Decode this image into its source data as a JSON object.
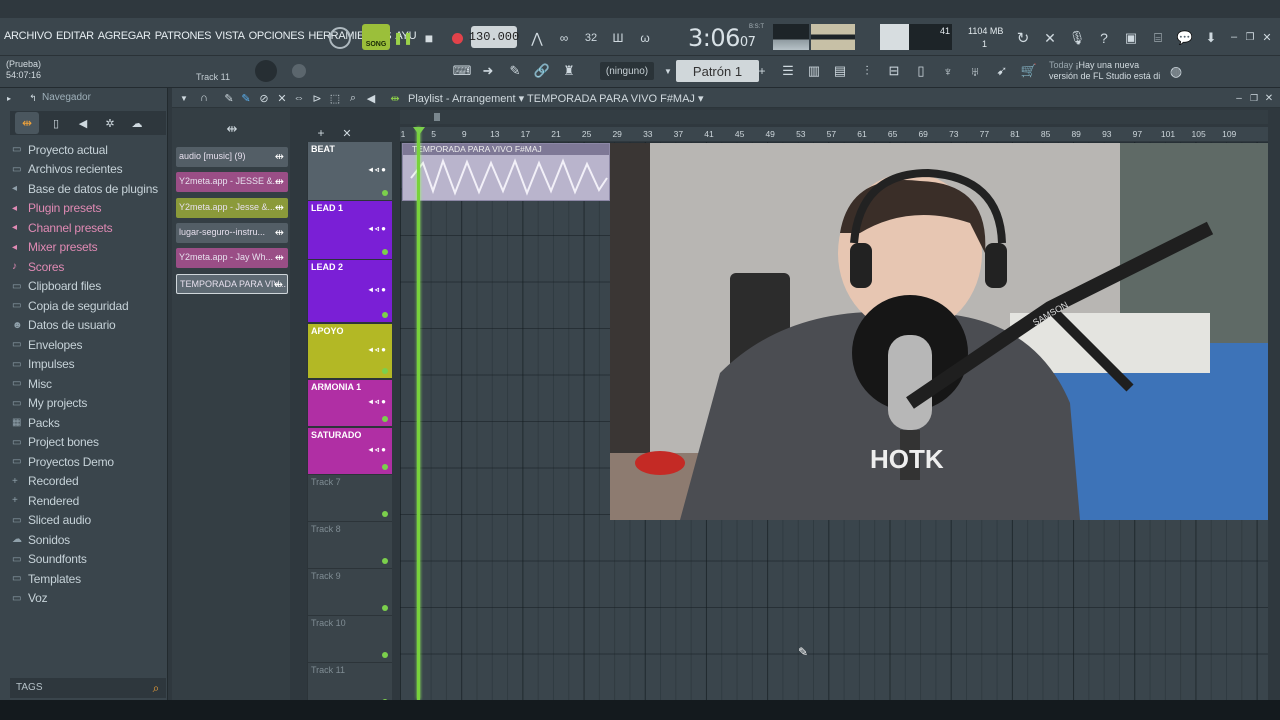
{
  "menu": {
    "items": [
      "ARCHIVO",
      "EDITAR",
      "AGREGAR",
      "PATRONES",
      "VISTA",
      "OPCIONES",
      "HERRAMIENTAS",
      "AYU"
    ]
  },
  "transport": {
    "song_label": "SONG",
    "tempo": "130.000",
    "time_main": "3:06",
    "time_sub": "07",
    "time_top": "B:S:T"
  },
  "monitor": {
    "cpu_value": "41",
    "memory": "1104 MB",
    "voices": "1"
  },
  "hint": {
    "line1": "(Prueba)",
    "line2": "54:07:16",
    "track": "Track 11"
  },
  "pattern": {
    "selector": "(ninguno)",
    "name": "Patrón 1"
  },
  "news": {
    "label": "Today",
    "line1": "¡Hay una nueva",
    "line2": "versión de FL Studio está di"
  },
  "browser": {
    "title": "Navegador",
    "items": [
      {
        "label": "Proyecto actual",
        "icon": "folder-icon",
        "color": "normal"
      },
      {
        "label": "Archivos recientes",
        "icon": "folder-icon",
        "color": "normal"
      },
      {
        "label": "Base de datos de plugins",
        "icon": "plug-icon",
        "color": "normal"
      },
      {
        "label": "Plugin presets",
        "icon": "plug-icon",
        "color": "pink"
      },
      {
        "label": "Channel presets",
        "icon": "plug-icon",
        "color": "pink"
      },
      {
        "label": "Mixer presets",
        "icon": "plug-icon",
        "color": "pink"
      },
      {
        "label": "Scores",
        "icon": "note-icon",
        "color": "pink"
      },
      {
        "label": "Clipboard files",
        "icon": "folder-icon",
        "color": "normal"
      },
      {
        "label": "Copia de seguridad",
        "icon": "folder-icon",
        "color": "normal"
      },
      {
        "label": "Datos de usuario",
        "icon": "user-icon",
        "color": "normal"
      },
      {
        "label": "Envelopes",
        "icon": "folder-icon",
        "color": "normal"
      },
      {
        "label": "Impulses",
        "icon": "folder-icon",
        "color": "normal"
      },
      {
        "label": "Misc",
        "icon": "folder-icon",
        "color": "normal"
      },
      {
        "label": "My projects",
        "icon": "folder-icon",
        "color": "normal"
      },
      {
        "label": "Packs",
        "icon": "pack-icon",
        "color": "normal"
      },
      {
        "label": "Project bones",
        "icon": "folder-icon",
        "color": "normal"
      },
      {
        "label": "Proyectos Demo",
        "icon": "folder-icon",
        "color": "normal"
      },
      {
        "label": "Recorded",
        "icon": "plus-icon",
        "color": "normal"
      },
      {
        "label": "Rendered",
        "icon": "plus-icon",
        "color": "normal"
      },
      {
        "label": "Sliced audio",
        "icon": "folder-icon",
        "color": "normal"
      },
      {
        "label": "Sonidos",
        "icon": "cloud-icon",
        "color": "normal"
      },
      {
        "label": "Soundfonts",
        "icon": "folder-icon",
        "color": "normal"
      },
      {
        "label": "Templates",
        "icon": "folder-icon",
        "color": "normal"
      },
      {
        "label": "Voz",
        "icon": "folder-icon",
        "color": "normal"
      }
    ],
    "tags_label": "TAGS"
  },
  "picker": {
    "clips": [
      {
        "label": "audio [music] (9)",
        "color": "#535e66"
      },
      {
        "label": "Y2meta.app - JESSE &...",
        "color": "#9a4e86"
      },
      {
        "label": "Y2meta.app - Jesse &...",
        "color": "#8b9a3a"
      },
      {
        "label": "lugar-seguro--instru...",
        "color": "#535e66"
      },
      {
        "label": "Y2meta.app - Jay Wh...",
        "color": "#9a4e86"
      },
      {
        "label": "TEMPORADA PARA VIV...",
        "color": "#5e6a73"
      }
    ]
  },
  "playlist": {
    "title": "Playlist - Arrangement",
    "arrangement": "TEMPORADA PARA VIVO F#MAJ",
    "ruler": [
      "1",
      "5",
      "9",
      "13",
      "17",
      "21",
      "25",
      "29",
      "33",
      "37",
      "41",
      "45",
      "49",
      "53",
      "57",
      "61",
      "65",
      "69",
      "73",
      "77",
      "81",
      "85",
      "89",
      "93",
      "97",
      "101",
      "105",
      "109"
    ],
    "tracks": [
      {
        "name": "BEAT",
        "color": "#56626b"
      },
      {
        "name": "LEAD 1",
        "color": "#7a1fd6"
      },
      {
        "name": "LEAD 2",
        "color": "#7a1fd6"
      },
      {
        "name": "APOYO",
        "color": "#b3b825"
      },
      {
        "name": "ARMONIA 1",
        "color": "#b02fa4"
      },
      {
        "name": "SATURADO",
        "color": "#b02fa4"
      },
      {
        "name": "Track 7",
        "color": "#3a444a"
      },
      {
        "name": "Track 8",
        "color": "#3a444a"
      },
      {
        "name": "Track 9",
        "color": "#3a444a"
      },
      {
        "name": "Track 10",
        "color": "#3a444a"
      },
      {
        "name": "Track 11",
        "color": "#3a444a"
      }
    ],
    "clip_label": "TEMPORADA PARA VIVO F#MAJ"
  },
  "webcam": {
    "shirt_text": "HOTK",
    "boom_text": "SAMSON"
  }
}
